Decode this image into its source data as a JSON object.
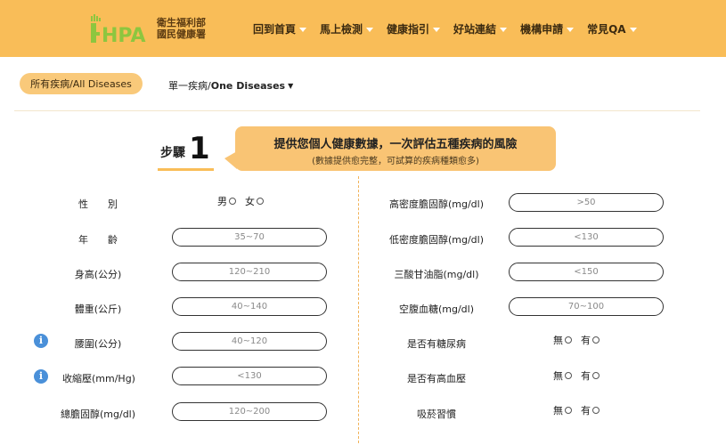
{
  "header": {
    "logo_text": "HPA",
    "org_line1": "衛生福利部",
    "org_line2": "國民健康署",
    "nav": [
      {
        "label": "回到首頁"
      },
      {
        "label": "馬上檢測"
      },
      {
        "label": "健康指引"
      },
      {
        "label": "好站連結"
      },
      {
        "label": "機構申請"
      },
      {
        "label": "常見QA"
      }
    ]
  },
  "tabs": {
    "all_label": "所有疾病/All Diseases",
    "one_prefix": "單一疾病/",
    "one_label": "One Diseases"
  },
  "step": {
    "label": "步驟",
    "number": "1",
    "title": "提供您個人健康數據，一次評估五種疾病的風險",
    "subtitle": "(數據提供愈完整，可試算的疾病種類愈多)"
  },
  "left_form": {
    "gender_label": "性　　別",
    "gender_options": [
      "男",
      "女"
    ],
    "age": {
      "label": "年　　齡",
      "placeholder": "35~70"
    },
    "height": {
      "label": "身高(公分)",
      "placeholder": "120~210"
    },
    "weight": {
      "label": "體重(公斤)",
      "placeholder": "40~140"
    },
    "waist": {
      "label": "腰圍(公分)",
      "placeholder": "40~120"
    },
    "systolic": {
      "label": "收縮壓(mm/Hg)",
      "placeholder": "<130"
    },
    "cholesterol": {
      "label": "總膽固醇(mg/dl)",
      "placeholder": "120~200"
    }
  },
  "right_form": {
    "hdl": {
      "label": "高密度膽固醇(mg/dl)",
      "placeholder": ">50"
    },
    "ldl": {
      "label": "低密度膽固醇(mg/dl)",
      "placeholder": "<130"
    },
    "triglyceride": {
      "label": "三酸甘油脂(mg/dl)",
      "placeholder": "<150"
    },
    "glucose": {
      "label": "空腹血糖(mg/dl)",
      "placeholder": "70~100"
    },
    "diabetes": {
      "label": "是否有糖尿病",
      "options": [
        "無",
        "有"
      ]
    },
    "hypertension": {
      "label": "是否有高血壓",
      "options": [
        "無",
        "有"
      ]
    },
    "smoking": {
      "label": "吸菸習慣",
      "options": [
        "無",
        "有"
      ]
    }
  },
  "info_icon_glyph": "i",
  "colors": {
    "header": "#f9bd58",
    "bubble": "#f9c474",
    "info": "#4a90d9"
  }
}
